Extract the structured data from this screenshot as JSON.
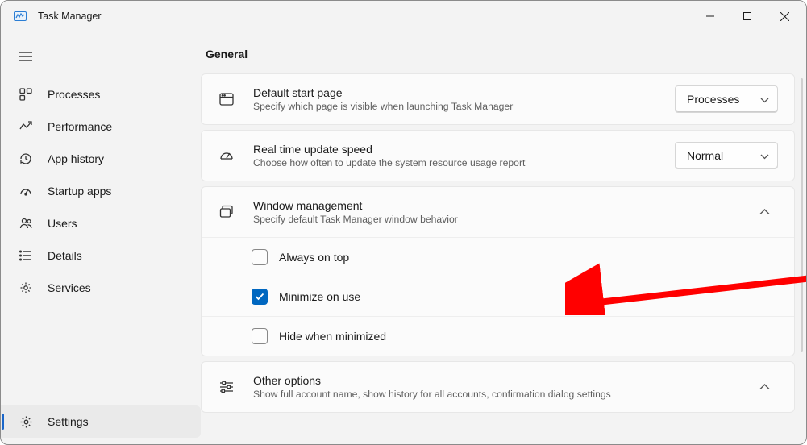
{
  "window": {
    "title": "Task Manager"
  },
  "sidebar": {
    "items": [
      {
        "label": "Processes"
      },
      {
        "label": "Performance"
      },
      {
        "label": "App history"
      },
      {
        "label": "Startup apps"
      },
      {
        "label": "Users"
      },
      {
        "label": "Details"
      },
      {
        "label": "Services"
      }
    ],
    "settings_label": "Settings"
  },
  "content": {
    "heading": "General",
    "cards": [
      {
        "title": "Default start page",
        "desc": "Specify which page is visible when launching Task Manager",
        "dropdown": "Processes"
      },
      {
        "title": "Real time update speed",
        "desc": "Choose how often to update the system resource usage report",
        "dropdown": "Normal"
      },
      {
        "title": "Window management",
        "desc": "Specify default Task Manager window behavior",
        "options": [
          {
            "label": "Always on top",
            "checked": false
          },
          {
            "label": "Minimize on use",
            "checked": true
          },
          {
            "label": "Hide when minimized",
            "checked": false
          }
        ]
      },
      {
        "title": "Other options",
        "desc": "Show full account name, show history for all accounts, confirmation dialog settings"
      }
    ]
  }
}
